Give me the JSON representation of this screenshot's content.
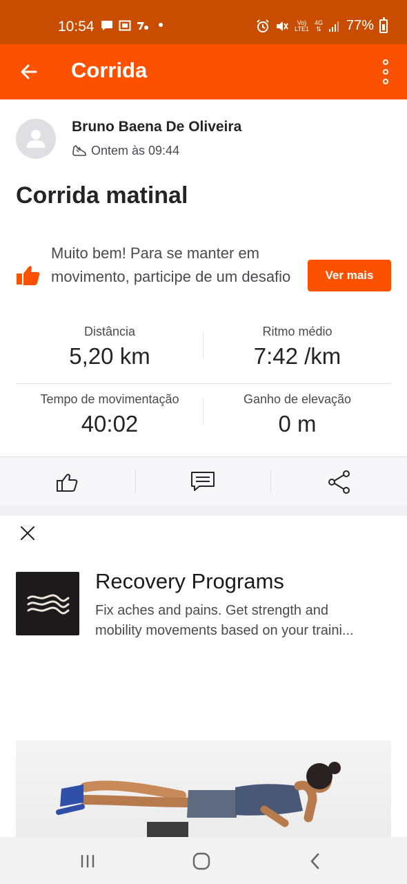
{
  "status_bar": {
    "time": "10:54",
    "network_top": "Vo)",
    "network_bottom": "LTE1",
    "net_type": "4G",
    "battery": "77%"
  },
  "app_bar": {
    "title": "Corrida"
  },
  "activity": {
    "athlete_name": "Bruno Baena De Oliveira",
    "timestamp": "Ontem às 09:44",
    "title": "Corrida matinal"
  },
  "promo": {
    "text": "Muito bem! Para se manter em movimento, participe de um desafio",
    "button_label": "Ver mais"
  },
  "stats": [
    {
      "label": "Distância",
      "value": "5,20 km"
    },
    {
      "label": "Ritmo médio",
      "value": "7:42 /km"
    },
    {
      "label": "Tempo de movimentação",
      "value": "40:02"
    },
    {
      "label": "Ganho de elevação",
      "value": "0 m"
    }
  ],
  "ad": {
    "title": "Recovery Programs",
    "description_line1": "Fix aches and pains. Get strength and",
    "description_line2": "mobility movements based on your traini..."
  },
  "colors": {
    "brand": "#fc5200",
    "status_bar": "#c94d00"
  }
}
